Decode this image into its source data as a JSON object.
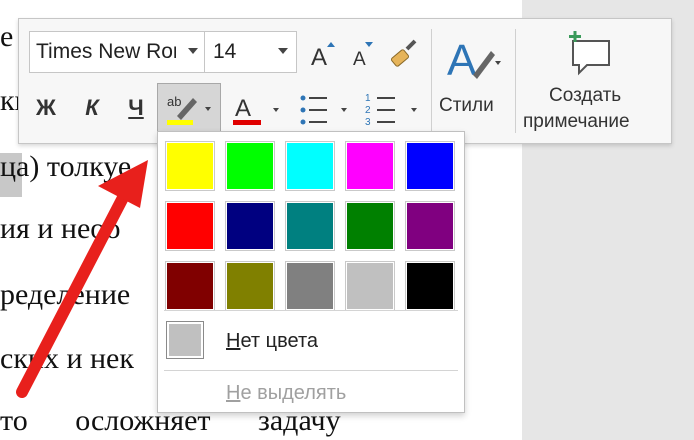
{
  "document": {
    "lines": [
      "е",
      "ки",
      "ца) толкуе",
      "ия и необ",
      "ределение",
      "ских и нек",
      "то осложняет задачу"
    ]
  },
  "toolbar": {
    "font_name": "Times New Roman",
    "font_size": "14",
    "bold_label": "Ж",
    "italic_label": "К",
    "underline_label": "Ч",
    "styles_label": "Стили",
    "comment_label_line1": "Создать",
    "comment_label_line2": "примечание",
    "highlight_color": "#ffff00",
    "font_color": "#e00000"
  },
  "palette": {
    "colors": [
      {
        "name": "yellow",
        "hex": "#ffff00"
      },
      {
        "name": "bright-green",
        "hex": "#00ff00"
      },
      {
        "name": "turquoise",
        "hex": "#00ffff"
      },
      {
        "name": "pink",
        "hex": "#ff00ff"
      },
      {
        "name": "blue",
        "hex": "#0000ff"
      },
      {
        "name": "red",
        "hex": "#ff0000"
      },
      {
        "name": "dark-blue",
        "hex": "#000080"
      },
      {
        "name": "teal",
        "hex": "#008080"
      },
      {
        "name": "green",
        "hex": "#008000"
      },
      {
        "name": "violet",
        "hex": "#800080"
      },
      {
        "name": "dark-red",
        "hex": "#800000"
      },
      {
        "name": "dark-yellow",
        "hex": "#808000"
      },
      {
        "name": "gray-50",
        "hex": "#808080"
      },
      {
        "name": "gray-25",
        "hex": "#c0c0c0"
      },
      {
        "name": "black",
        "hex": "#000000"
      }
    ],
    "no_color_first": "Н",
    "no_color_rest": "ет цвета",
    "no_highlight_first": "Н",
    "no_highlight_rest": "е выделять"
  }
}
